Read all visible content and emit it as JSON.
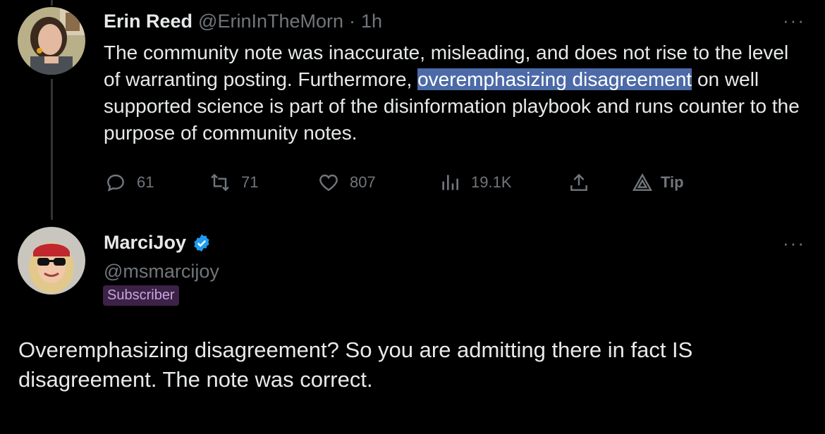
{
  "tweet1": {
    "name": "Erin Reed",
    "handle": "@ErinInTheMorn",
    "sep": "·",
    "time": "1h",
    "more": "···",
    "text_before": "The community note was inaccurate, misleading, and does not rise to the level of warranting posting. Furthermore, ",
    "text_highlight": "overemphasizing disagreement",
    "text_after": " on well supported science is part of the disinformation playbook and runs counter to the purpose of community notes.",
    "actions": {
      "replies": "61",
      "retweets": "71",
      "likes": "807",
      "views": "19.1K",
      "tip": "Tip"
    }
  },
  "tweet2": {
    "name": "MarciJoy",
    "handle": "@msmarcijoy",
    "badge": "Subscriber",
    "more": "···",
    "text": "Overemphasizing disagreement? So you are admitting there in fact IS disagreement. The note was correct."
  },
  "colors": {
    "background": "#000000",
    "text": "#e7e9ea",
    "muted": "#71767b",
    "verified": "#1d9bf0",
    "highlight": "#4c6aa8",
    "subscriber_bg": "#3b2246"
  },
  "icons": [
    "reply-icon",
    "retweet-icon",
    "like-icon",
    "views-icon",
    "share-icon",
    "tip-icon",
    "verified-icon",
    "more-icon"
  ]
}
